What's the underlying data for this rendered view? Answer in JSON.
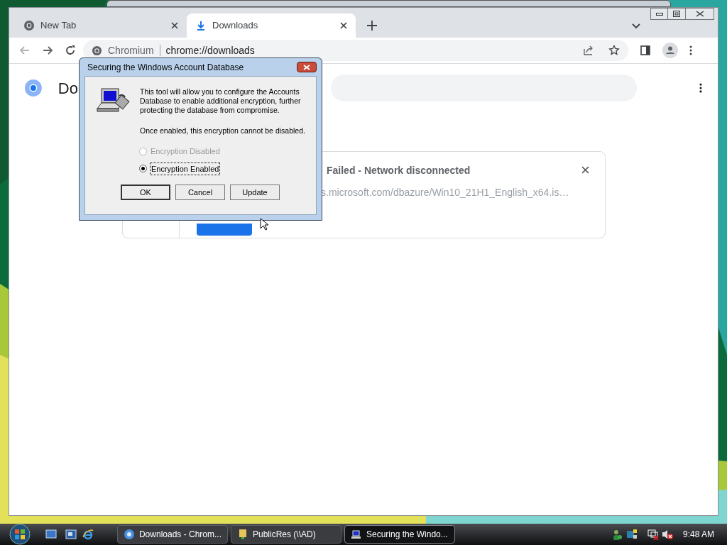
{
  "browser": {
    "tabs": [
      {
        "label": "New Tab",
        "selected": false,
        "kind": "chromium"
      },
      {
        "label": "Downloads",
        "selected": true,
        "kind": "download"
      }
    ],
    "address": {
      "site": "Chromium",
      "url": "chrome://downloads"
    }
  },
  "page": {
    "title": "Do",
    "download": {
      "status": "Failed - Network disconnected",
      "url": "s.microsoft.com/dbazure/Win10_21H1_English_x64.is…"
    }
  },
  "dialog": {
    "title": "Securing the Windows Account Database",
    "paragraphs": [
      "This tool will allow you to configure the Accounts Database to enable additional encryption, further protecting the database from compromise.",
      "Once enabled, this encryption cannot be disabled."
    ],
    "radios": [
      {
        "label": "Encryption Disabled",
        "selected": false,
        "disabled": true
      },
      {
        "label": "Encryption Enabled",
        "selected": true,
        "disabled": false
      }
    ],
    "buttons": [
      {
        "label": "OK",
        "default": true
      },
      {
        "label": "Cancel",
        "default": false
      },
      {
        "label": "Update",
        "default": false
      }
    ]
  },
  "taskbar": {
    "tasks": [
      {
        "label": "Downloads - Chrom...",
        "selected": false,
        "kind": "chromium"
      },
      {
        "label": "PublicRes (\\\\AD)",
        "selected": false,
        "kind": "folder"
      },
      {
        "label": "Securing the Windo...",
        "selected": true,
        "kind": "tool"
      }
    ],
    "clock": "9:48 AM"
  }
}
